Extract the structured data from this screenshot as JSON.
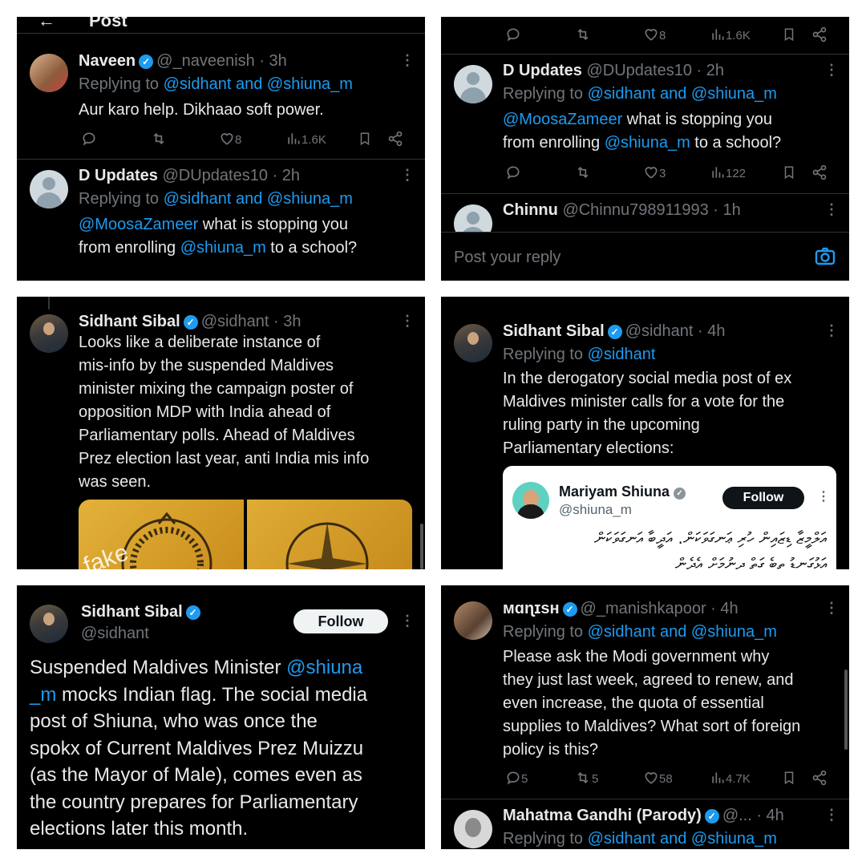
{
  "p1": {
    "header_title": "Post",
    "t1": {
      "name": "Naveen",
      "handle": "@_naveenish · 3h",
      "replying": "Replying to",
      "mentions": "@sidhant and @shiuna_m",
      "body": "Aur karo help. Dikhaao soft power.",
      "likes": "8",
      "views": "1.6K"
    },
    "t2": {
      "name": "D Updates",
      "handle": "@DUpdates10 · 2h",
      "replying": "Replying to",
      "mentions": "@sidhant and @shiuna_m",
      "mention1": "@MoosaZameer",
      "body1": " what is stopping you",
      "body2a": "from enrolling ",
      "mention2": "@shiuna_m",
      "body2b": " to a school?",
      "likes": "3",
      "views": "122"
    }
  },
  "p2": {
    "top": {
      "likes": "8",
      "views": "1.6K"
    },
    "t1": {
      "name": "D Updates",
      "handle": "@DUpdates10 · 2h",
      "replying": "Replying to",
      "mentions": "@sidhant and @shiuna_m",
      "mention1": "@MoosaZameer",
      "body1": " what is stopping you",
      "body2a": "from enrolling ",
      "mention2": "@shiuna_m",
      "body2b": " to a school?",
      "likes": "3",
      "views": "122"
    },
    "t2": {
      "name": "Chinnu",
      "handle": "@Chinnu798911993 · 1h"
    },
    "reply_placeholder": "Post your reply"
  },
  "p3": {
    "name": "Sidhant Sibal",
    "handle": "@sidhant · 3h",
    "lines": [
      "Looks like a deliberate instance of",
      "mis-info by the suspended Maldives",
      "minister mixing the campaign poster of",
      "opposition MDP with India ahead of",
      "Parliamentary polls. Ahead of Maldives",
      "Prez election last year, anti India mis info",
      "was seen."
    ],
    "image_label": "fake"
  },
  "p4": {
    "name": "Sidhant Sibal",
    "handle": "@sidhant · 4h",
    "replying": "Replying to",
    "mentions": "@sidhant",
    "lines": [
      "In the derogatory social media post of ex",
      "Maldives minister calls for a vote for the",
      "ruling party in the upcoming",
      "Parliamentary elections:"
    ],
    "embed": {
      "name": "Mariyam Shiuna",
      "handle": "@shiuna_m",
      "follow": "Follow",
      "line1": "އަލްމީޒާ ޑިޒައިން ހުރި ޢަނގަވަކަން. އަދީބާ އަނގަވަކަން",
      "line2": "އަޅުގަނޑު ތިބެ ގަތް ދިނުމަށް އެދެން"
    }
  },
  "p5": {
    "name": "Sidhant Sibal",
    "handle": "@sidhant",
    "follow": "Follow",
    "l1a": "Suspended Maldives Minister ",
    "l1b": "@shiuna",
    "l2a": "_m",
    "l2b": " mocks Indian flag. The social media",
    "lines": [
      "post of Shiuna, who was once the",
      "spokx of Current Maldives Prez Muizzu",
      "(as the Mayor of Male), comes even as",
      "the country prepares for Parliamentary",
      "elections later this month."
    ]
  },
  "p6": {
    "t1": {
      "name": "ᴍɑɳɪsʜ",
      "handle": "@_manishkapoor · 4h",
      "replying": "Replying to",
      "mentions": "@sidhant and @shiuna_m",
      "lines": [
        "Please ask the Modi government why",
        "they just last week, agreed to renew, and",
        "even increase, the quota of essential",
        "supplies to Maldives? What sort of foreign",
        "policy is this?"
      ],
      "replies": "5",
      "reposts": "5",
      "likes": "58",
      "views": "4.7K"
    },
    "t2": {
      "name": "Mahatma Gandhi (Parody)",
      "handle": "@... · 4h",
      "replying": "Replying to",
      "mentions": "@sidhant and @shiuna_m"
    }
  }
}
